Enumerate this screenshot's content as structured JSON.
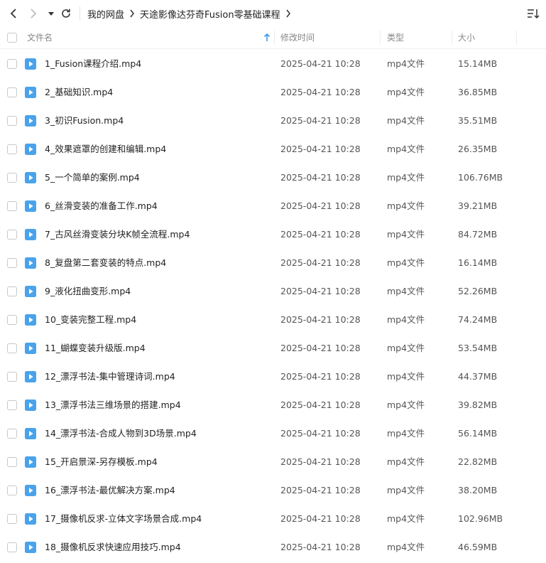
{
  "toolbar": {
    "breadcrumb": [
      "我的网盘",
      "天途影像达芬奇Fusion零基础课程"
    ]
  },
  "columns": {
    "name": "文件名",
    "modified": "修改时间",
    "type": "类型",
    "size": "大小"
  },
  "files": [
    {
      "name": "1_Fusion课程介绍.mp4",
      "modified": "2025-04-21 10:28",
      "type": "mp4文件",
      "size": "15.14MB"
    },
    {
      "name": "2_基础知识.mp4",
      "modified": "2025-04-21 10:28",
      "type": "mp4文件",
      "size": "36.85MB"
    },
    {
      "name": "3_初识Fusion.mp4",
      "modified": "2025-04-21 10:28",
      "type": "mp4文件",
      "size": "35.51MB"
    },
    {
      "name": "4_效果遮罩的创建和编辑.mp4",
      "modified": "2025-04-21 10:28",
      "type": "mp4文件",
      "size": "26.35MB"
    },
    {
      "name": "5_一个简单的案例.mp4",
      "modified": "2025-04-21 10:28",
      "type": "mp4文件",
      "size": "106.76MB"
    },
    {
      "name": "6_丝滑变装的准备工作.mp4",
      "modified": "2025-04-21 10:28",
      "type": "mp4文件",
      "size": "39.21MB"
    },
    {
      "name": "7_古风丝滑变装分块K帧全流程.mp4",
      "modified": "2025-04-21 10:28",
      "type": "mp4文件",
      "size": "84.72MB"
    },
    {
      "name": "8_复盘第二套变装的特点.mp4",
      "modified": "2025-04-21 10:28",
      "type": "mp4文件",
      "size": "16.14MB"
    },
    {
      "name": "9_液化扭曲变形.mp4",
      "modified": "2025-04-21 10:28",
      "type": "mp4文件",
      "size": "52.26MB"
    },
    {
      "name": "10_变装完整工程.mp4",
      "modified": "2025-04-21 10:28",
      "type": "mp4文件",
      "size": "74.24MB"
    },
    {
      "name": "11_蝴蝶变装升级版.mp4",
      "modified": "2025-04-21 10:28",
      "type": "mp4文件",
      "size": "53.54MB"
    },
    {
      "name": "12_漂浮书法-集中管理诗词.mp4",
      "modified": "2025-04-21 10:28",
      "type": "mp4文件",
      "size": "44.37MB"
    },
    {
      "name": "13_漂浮书法三维场景的搭建.mp4",
      "modified": "2025-04-21 10:28",
      "type": "mp4文件",
      "size": "39.82MB"
    },
    {
      "name": "14_漂浮书法-合成人物到3D场景.mp4",
      "modified": "2025-04-21 10:28",
      "type": "mp4文件",
      "size": "56.14MB"
    },
    {
      "name": "15_开启景深-另存模板.mp4",
      "modified": "2025-04-21 10:28",
      "type": "mp4文件",
      "size": "22.82MB"
    },
    {
      "name": "16_漂浮书法-最优解决方案.mp4",
      "modified": "2025-04-21 10:28",
      "type": "mp4文件",
      "size": "38.20MB"
    },
    {
      "name": "17_摄像机反求-立体文字场景合成.mp4",
      "modified": "2025-04-21 10:28",
      "type": "mp4文件",
      "size": "102.96MB"
    },
    {
      "name": "18_摄像机反求快速应用技巧.mp4",
      "modified": "2025-04-21 10:28",
      "type": "mp4文件",
      "size": "46.59MB"
    }
  ],
  "icons": {
    "back": "chevron-left-icon",
    "forward": "chevron-right-icon",
    "history": "caret-down-icon",
    "refresh": "refresh-icon",
    "sort": "sort-list-icon",
    "sort_direction": "arrow-up-icon",
    "file": "video-file-icon"
  },
  "colors": {
    "accent": "#3a9be8",
    "file_icon": "#4aa3ea"
  }
}
